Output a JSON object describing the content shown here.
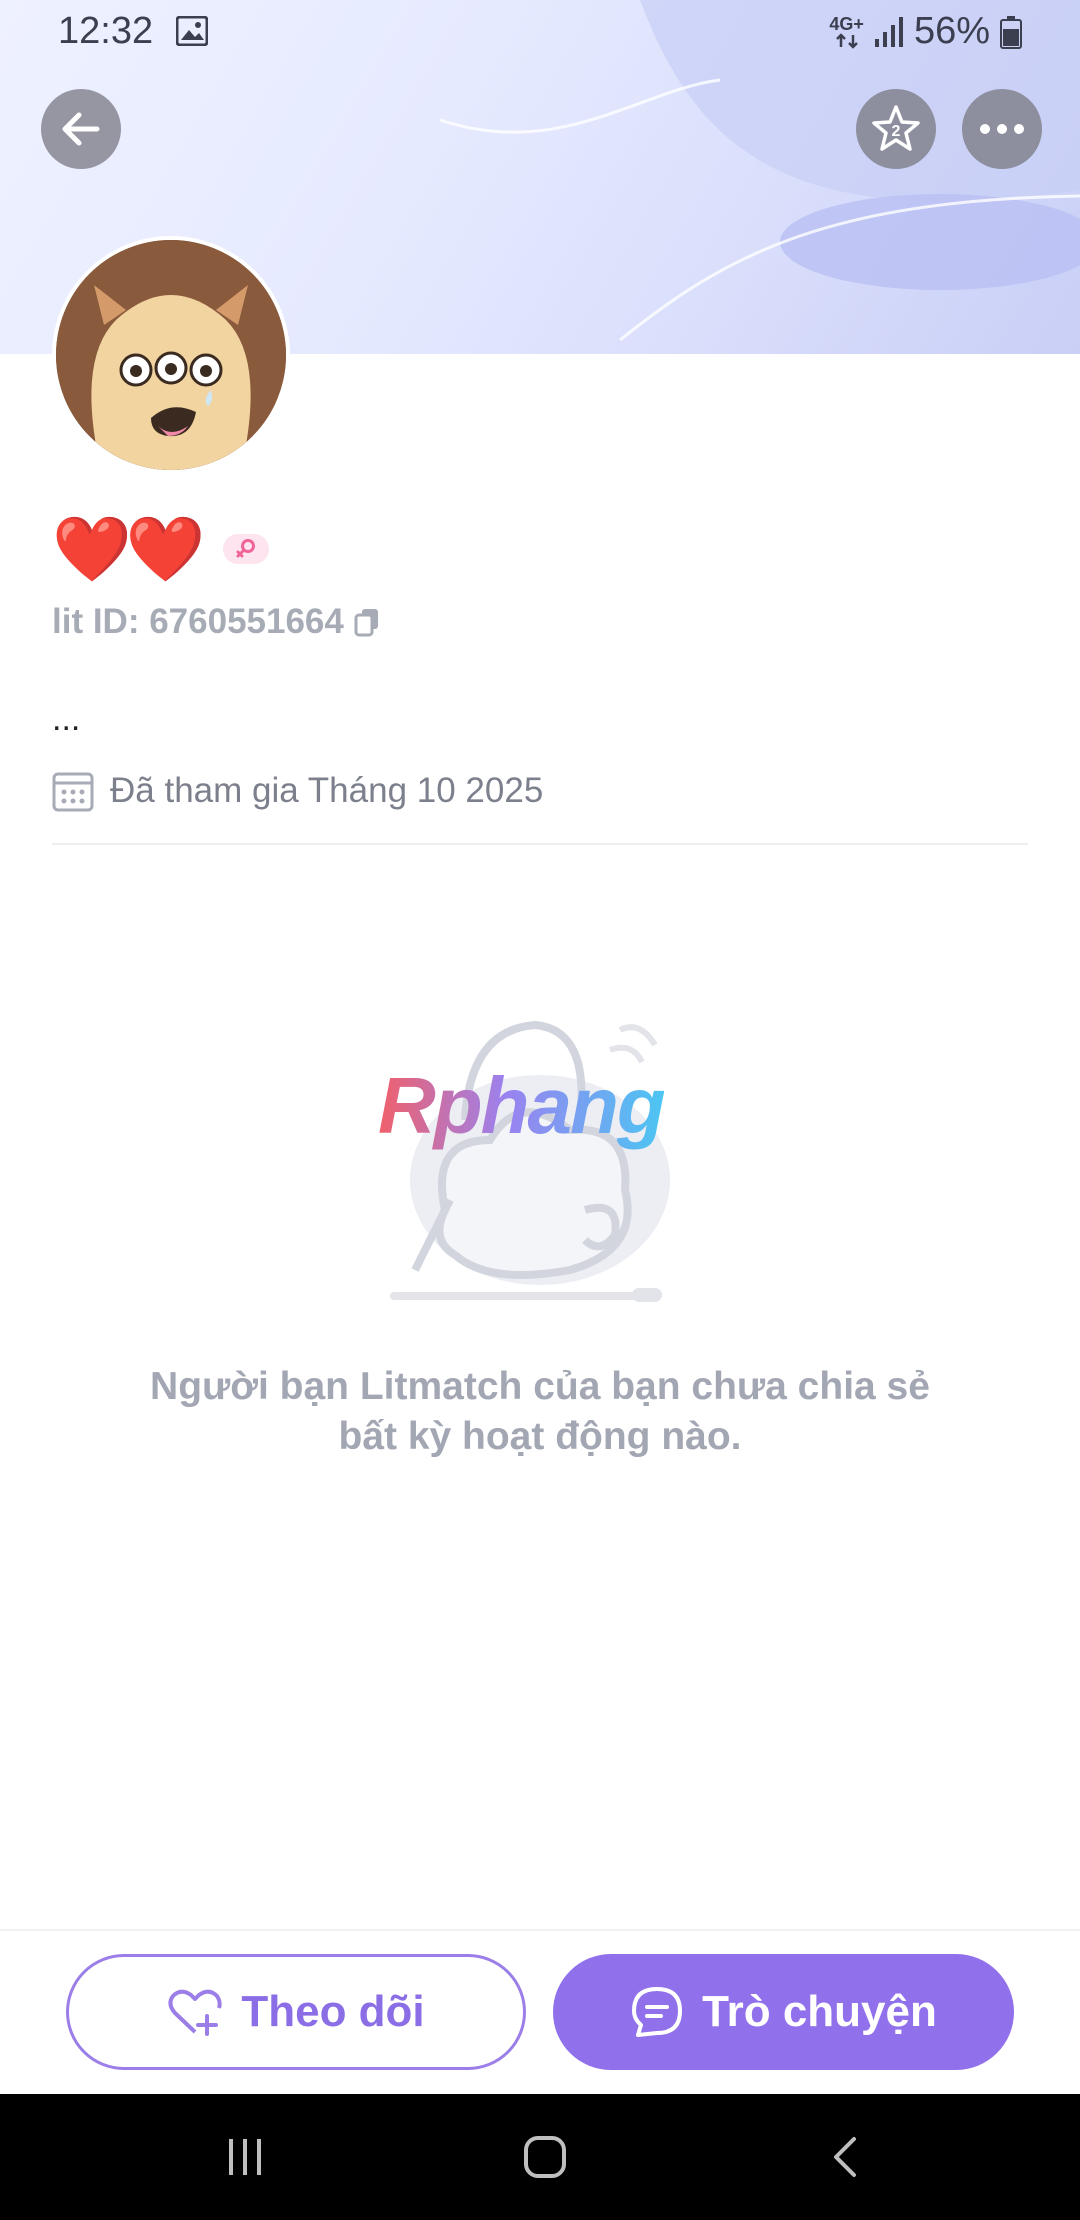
{
  "status_bar": {
    "time": "12:32",
    "network_label": "4G+",
    "battery_percent": "56%"
  },
  "profile": {
    "name": "❤️❤️",
    "lit_id_label": "lit ID: 6760551664",
    "bio": "...",
    "joined": "Đã tham gia Tháng 10 2025"
  },
  "empty_state": {
    "watermark": "Rphang",
    "message": "Người bạn Litmatch của bạn chưa chia sẻ bất kỳ hoạt động nào."
  },
  "actions": {
    "follow_label": "Theo dõi",
    "chat_label": "Trò chuyện"
  },
  "colors": {
    "accent": "#9170ec",
    "text_muted": "#a3a7b3",
    "heart": "#e0131b"
  }
}
